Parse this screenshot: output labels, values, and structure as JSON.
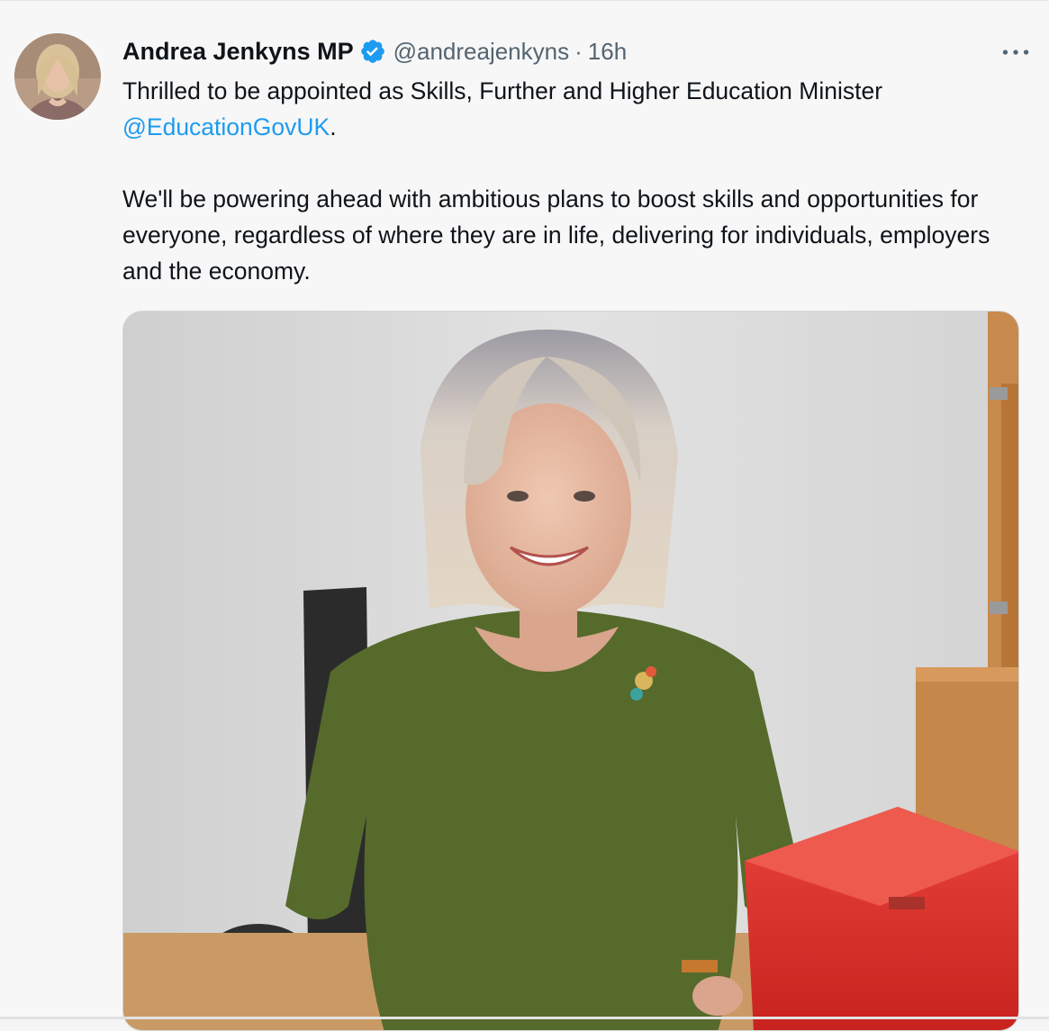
{
  "tweet": {
    "author": {
      "display_name": "Andrea Jenkyns MP",
      "handle": "@andreajenkyns",
      "verified": true,
      "avatar_icon": "profile-photo"
    },
    "separator": "·",
    "timestamp": "16h",
    "more_icon": "more-horizontal-icon",
    "text": {
      "line1_prefix": "Thrilled to be appointed as Skills, Further and Higher Education Minister ",
      "mention": "@EducationGovUK",
      "line1_suffix": ".",
      "paragraph2": "We'll be powering ahead with ambitious plans to boost skills and opportunities for everyone, regardless of where they are in life, delivering for individuals, employers and the economy."
    },
    "media": {
      "type": "photo",
      "description_icon": "tweet-photo"
    }
  },
  "colors": {
    "link": "#1d9bf0",
    "verified": "#1d9bf0",
    "text": "#0f1419",
    "secondary": "#536471",
    "background": "#f7f7f7"
  }
}
